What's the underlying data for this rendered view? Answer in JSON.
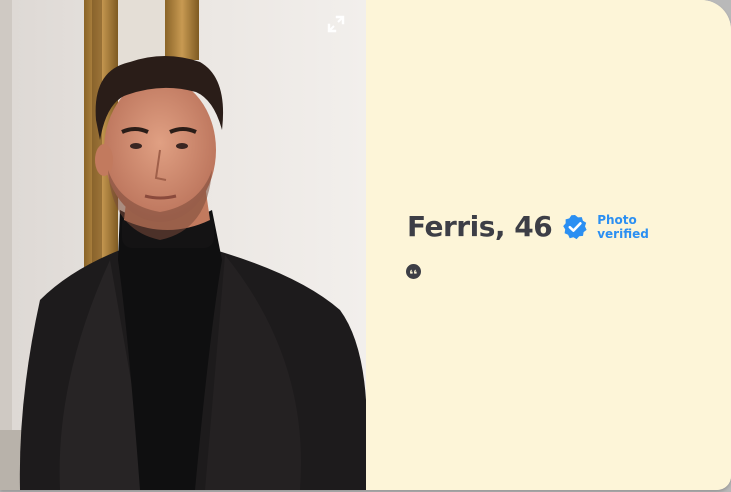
{
  "profile": {
    "name_age": "Ferris, 46",
    "verified_line1": "Photo",
    "verified_line2": "verified"
  },
  "icons": {
    "expand": "expand-photo-icon",
    "verified": "verified-badge-icon",
    "prompt": "quote-icon"
  },
  "colors": {
    "info_background": "#fdf5d8",
    "name_text": "#3d3e46",
    "verified_accent": "#2b8ff2"
  }
}
